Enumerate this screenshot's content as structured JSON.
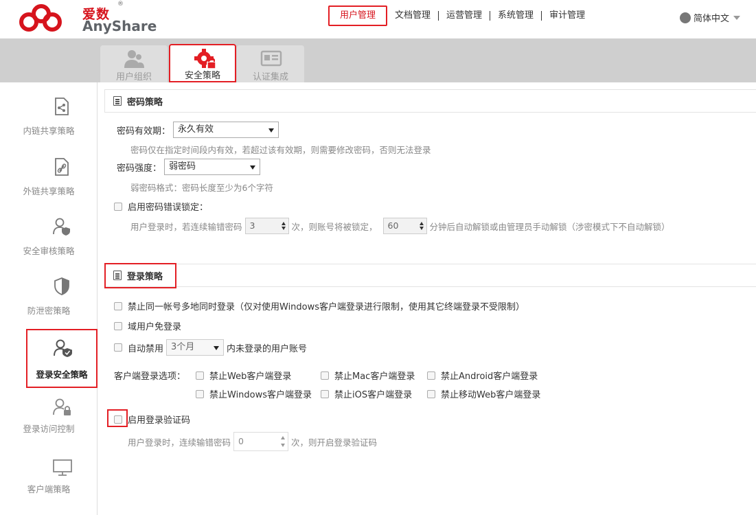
{
  "brand": {
    "name_zh": "爱数",
    "name_en": "AnyShare",
    "reg": "®"
  },
  "nav": {
    "items": [
      "用户管理",
      "文档管理",
      "运营管理",
      "系统管理",
      "审计管理"
    ],
    "active": "用户管理",
    "language": "简体中文"
  },
  "tabs": [
    {
      "label": "用户组织",
      "icon": "users-icon",
      "active": false
    },
    {
      "label": "安全策略",
      "icon": "gear-lock-icon",
      "active": true
    },
    {
      "label": "认证集成",
      "icon": "id-card-icon",
      "active": false
    }
  ],
  "sidebar": [
    {
      "label": "内链共享策略",
      "icon": "share-doc-icon",
      "active": false
    },
    {
      "label": "外链共享策略",
      "icon": "link-doc-icon",
      "active": false
    },
    {
      "label": "安全审核策略",
      "icon": "user-shield-icon",
      "active": false
    },
    {
      "label": "防泄密策略",
      "icon": "shield-icon",
      "active": false
    },
    {
      "label": "登录安全策略",
      "icon": "user-check-icon",
      "active": true
    },
    {
      "label": "登录访问控制",
      "icon": "user-lock-icon",
      "active": false
    },
    {
      "label": "客户端策略",
      "icon": "monitor-icon",
      "active": false
    }
  ],
  "password_policy": {
    "title": "密码策略",
    "validity_label": "密码有效期：",
    "validity_value": "永久有效",
    "validity_hint": "密码仅在指定时间段内有效，若超过该有效期，则需要修改密码，否则无法登录",
    "strength_label": "密码强度：",
    "strength_value": "弱密码",
    "strength_hint": "弱密码格式：密码长度至少为6个字符",
    "lockout_label": "启用密码错误锁定：",
    "lockout_text_1": "用户登录时，若连续输错密码",
    "lockout_attempts": "3",
    "lockout_text_2": "次，则账号将被锁定，",
    "lockout_minutes": "60",
    "lockout_text_3": "分钟后自动解锁或由管理员手动解锁（涉密模式下不自动解锁）"
  },
  "login_policy": {
    "title": "登录策略",
    "multi_login": "禁止同一帐号多地同时登录（仅对使用Windows客户端登录进行限制，使用其它终端登录不受限制）",
    "domain_free": "域用户免登录",
    "auto_disable_label": "自动禁用",
    "auto_disable_value": "3个月",
    "auto_disable_suffix": "内未登录的用户账号",
    "client_options_label": "客户端登录选项：",
    "client_options": [
      "禁止Web客户端登录",
      "禁止Mac客户端登录",
      "禁止Android客户端登录",
      "禁止Windows客户端登录",
      "禁止iOS客户端登录",
      "禁止移动Web客户端登录"
    ],
    "captcha_label": "启用登录验证码",
    "captcha_text_1": "用户登录时，连续输错密码",
    "captcha_attempts": "0",
    "captcha_text_2": "次，则开启登录验证码"
  }
}
